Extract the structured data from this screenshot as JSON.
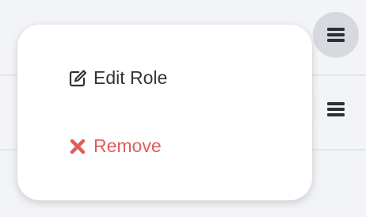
{
  "actions_menu": {
    "items": [
      {
        "label": "Edit Role",
        "icon": "edit-icon"
      },
      {
        "label": "Remove",
        "icon": "remove-icon"
      }
    ]
  },
  "row_menu_buttons": [
    {
      "icon": "hamburger-icon",
      "state": "active"
    },
    {
      "icon": "hamburger-icon",
      "state": "idle"
    }
  ],
  "colors": {
    "danger": "#e15d5d",
    "text": "#2f343b",
    "menu_background": "#ffffff",
    "page_background": "#f1f3f6"
  }
}
